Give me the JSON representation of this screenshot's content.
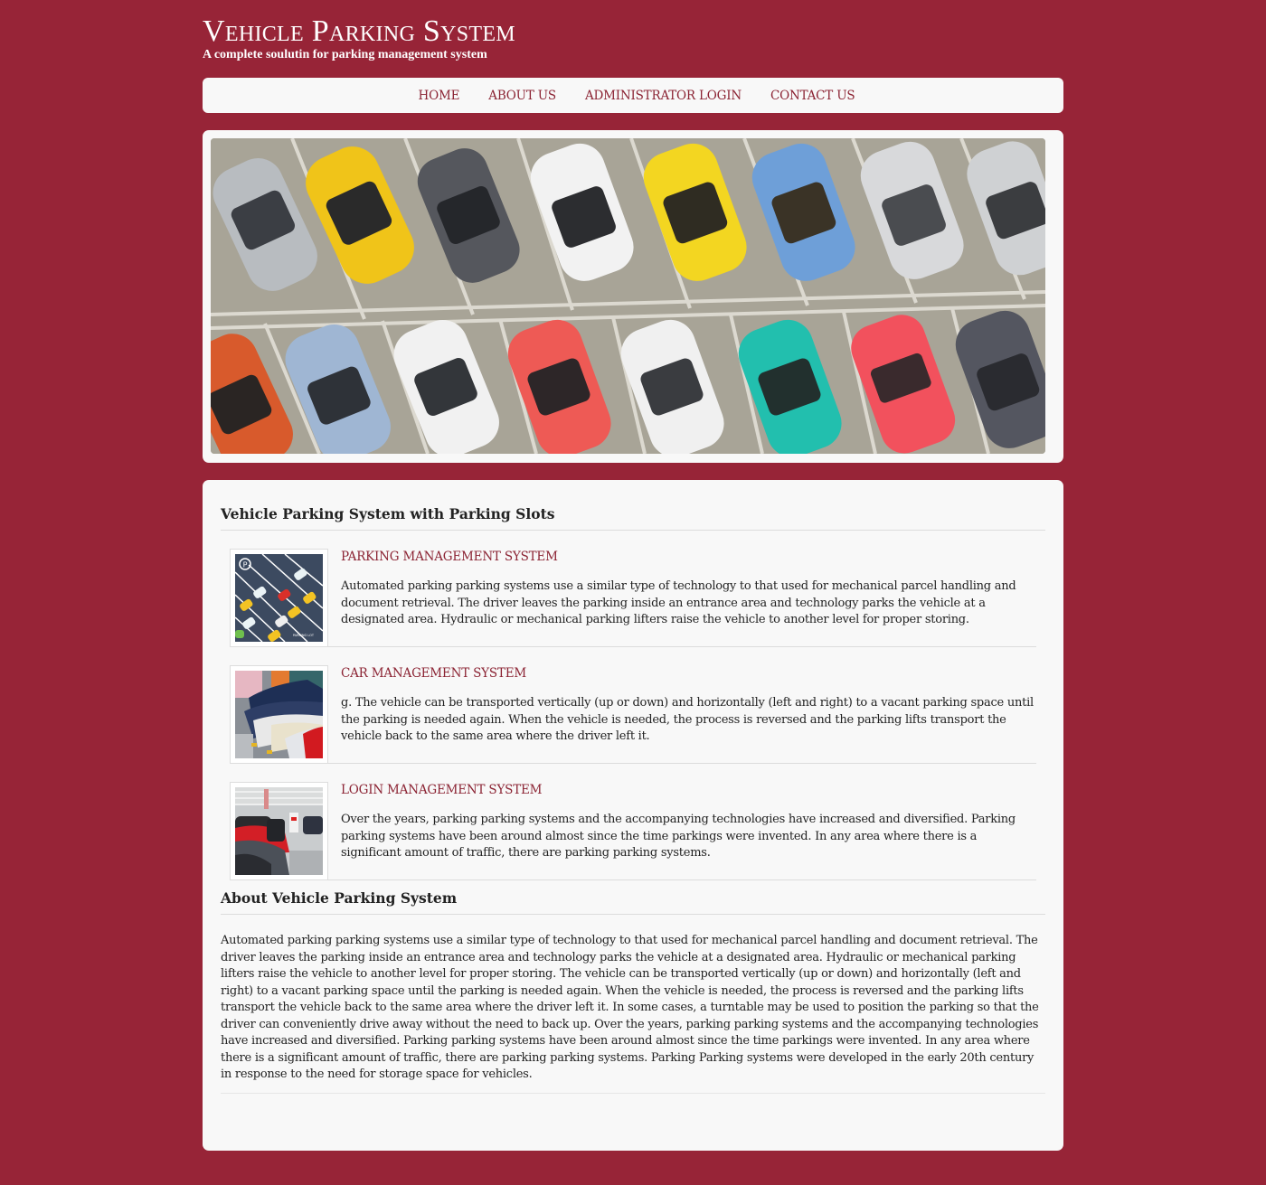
{
  "header": {
    "title": "Vehicle Parking System",
    "subtitle": "A complete soulutin for parking management system"
  },
  "nav": {
    "items": [
      {
        "label": "HOME"
      },
      {
        "label": "ABOUT US"
      },
      {
        "label": "ADMINISTRATOR LOGIN"
      },
      {
        "label": "CONTACT US"
      }
    ]
  },
  "banner": {
    "image": "aerial-parking-lot-photo"
  },
  "main": {
    "heading": "Vehicle Parking System with Parking Slots",
    "features": [
      {
        "image": "parking-lot-illustration",
        "title": "PARKING MANAGEMENT SYSTEM",
        "text": "Automated parking parking systems use a similar type of technology to that used for mechanical parcel handling and document retrieval. The driver leaves the parking inside an entrance area and technology parks the vehicle at a designated area. Hydraulic or mechanical parking lifters raise the vehicle to another level for proper storing."
      },
      {
        "image": "parked-cars-photo",
        "title": "CAR MANAGEMENT SYSTEM",
        "text": "g. The vehicle can be transported vertically (up or down) and horizontally (left and right) to a vacant parking space until the parking is needed again. When the vehicle is needed, the process is reversed and the parking lifts transport the vehicle back to the same area where the driver left it."
      },
      {
        "image": "parking-garage-photo",
        "title": "LOGIN MANAGEMENT SYSTEM",
        "text": "Over the years, parking parking systems and the accompanying technologies have increased and diversified. Parking parking systems have been around almost since the time parkings were invented. In any area where there is a significant amount of traffic, there are parking parking systems."
      }
    ],
    "about_heading": "About Vehicle Parking System",
    "about_text": "Automated parking parking systems use a similar type of technology to that used for mechanical parcel handling and document retrieval. The driver leaves the parking inside an entrance area and technology parks the vehicle at a designated area. Hydraulic or mechanical parking lifters raise the vehicle to another level for proper storing. The vehicle can be transported vertically (up or down) and horizontally (left and right) to a vacant parking space until the parking is needed again. When the vehicle is needed, the process is reversed and the parking lifts transport the vehicle back to the same area where the driver left it. In some cases, a turntable may be used to position the parking so that the driver can conveniently drive away without the need to back up. Over the years, parking parking systems and the accompanying technologies have increased and diversified. Parking parking systems have been around almost since the time parkings were invented. In any area where there is a significant amount of traffic, there are parking parking systems. Parking Parking systems were developed in the early 20th century in response to the need for storage space for vehicles."
  },
  "colors": {
    "background": "#972437",
    "accent": "#8b2333",
    "panel": "#f8f8f8"
  }
}
